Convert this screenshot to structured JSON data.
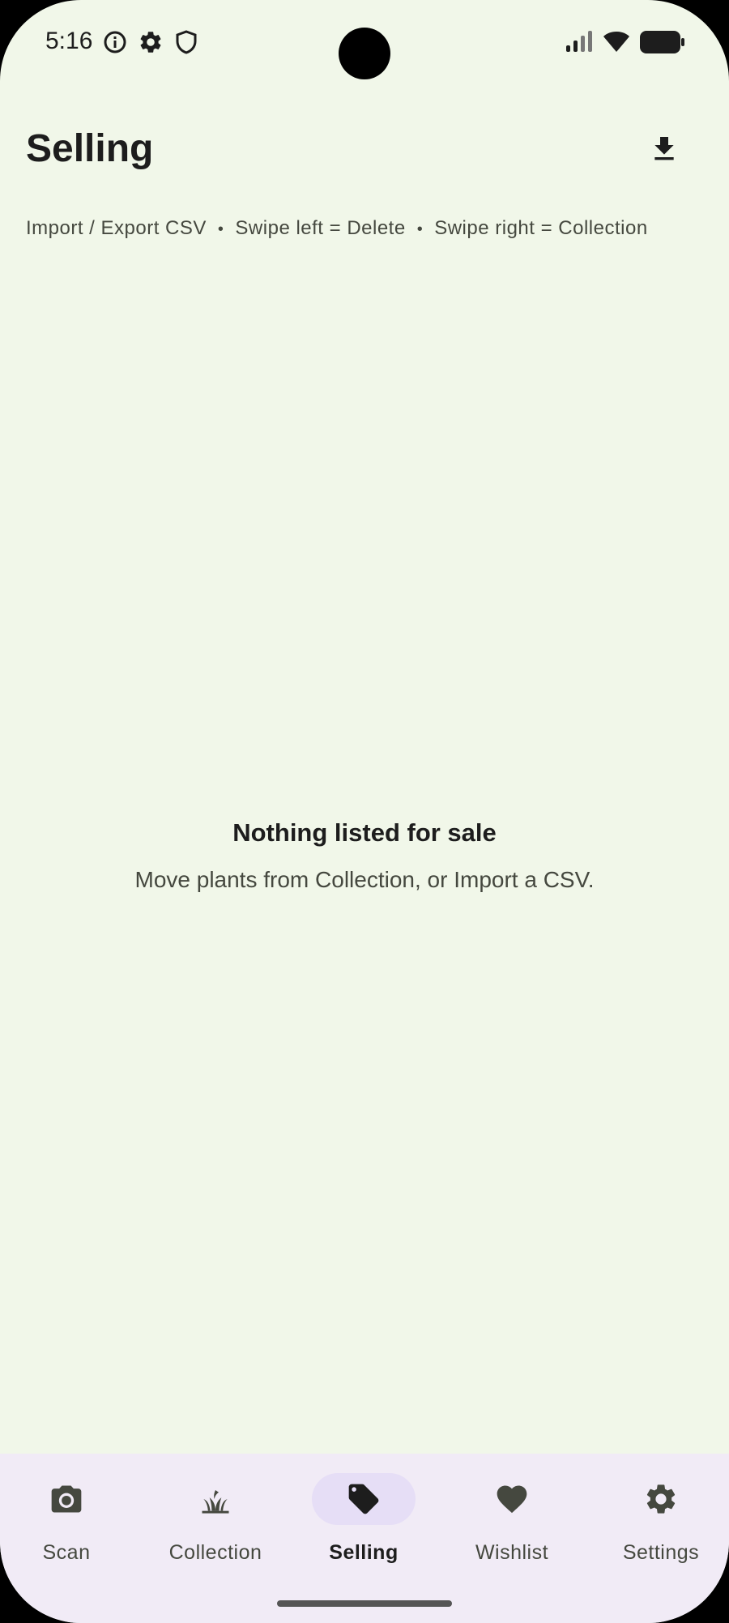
{
  "status_bar": {
    "time": "5:16",
    "left_icons": [
      "info-icon",
      "settings-gear-icon",
      "shield-icon"
    ],
    "right_icons": [
      "signal-icon",
      "wifi-icon",
      "battery-icon"
    ]
  },
  "header": {
    "title": "Selling",
    "action_icon": "download-icon"
  },
  "hints": {
    "import_export": "Import / Export CSV",
    "separator": "•",
    "swipe_left": "Swipe left = Delete",
    "swipe_right": "Swipe right = Collection"
  },
  "empty_state": {
    "title": "Nothing listed for sale",
    "subtitle": "Move plants from Collection, or Import a CSV."
  },
  "bottom_nav": {
    "active": "Selling",
    "items": [
      {
        "label": "Scan",
        "icon": "camera-icon"
      },
      {
        "label": "Collection",
        "icon": "plant-icon"
      },
      {
        "label": "Selling",
        "icon": "tag-icon"
      },
      {
        "label": "Wishlist",
        "icon": "heart-icon"
      },
      {
        "label": "Settings",
        "icon": "gear-icon"
      }
    ]
  },
  "colors": {
    "background": "#f1f7e9",
    "nav_background": "#f1ebf6",
    "active_indicator": "#e6def6",
    "text_primary": "#1d1d1d",
    "text_secondary": "#45483f"
  }
}
